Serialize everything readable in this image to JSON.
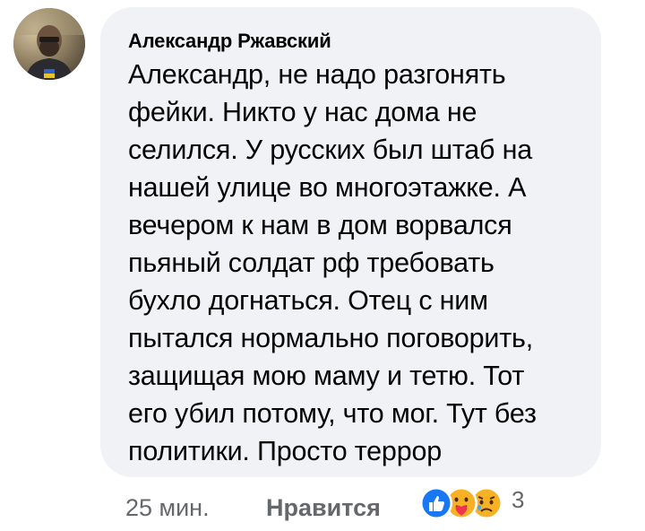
{
  "comment": {
    "author": "Александр Ржавский",
    "text_lines": [
      "Александр, не надо разгонять",
      "фейки. Никто у нас дома не",
      "селился. У русских был штаб на",
      "нашей улице во многоэтажке. А",
      "вечером к нам в дом ворвался",
      "пьяный солдат рф требовать",
      "бухло догнаться. Отец с ним",
      "пытался нормально поговорить,",
      "защищая мою маму и тетю. Тот",
      "его убил потому, что мог. Тут без",
      "политики. Просто террор"
    ],
    "time": "25 мин.",
    "like_label": "Нравится",
    "reactions": {
      "icons": [
        "like-icon",
        "care-icon",
        "sad-icon"
      ],
      "count": "3"
    }
  },
  "colors": {
    "bubble": "#f0f2f5",
    "text": "#050505",
    "meta": "#65676b",
    "like_blue": "#1877f2",
    "emoji_yellow": "#f7b125"
  }
}
